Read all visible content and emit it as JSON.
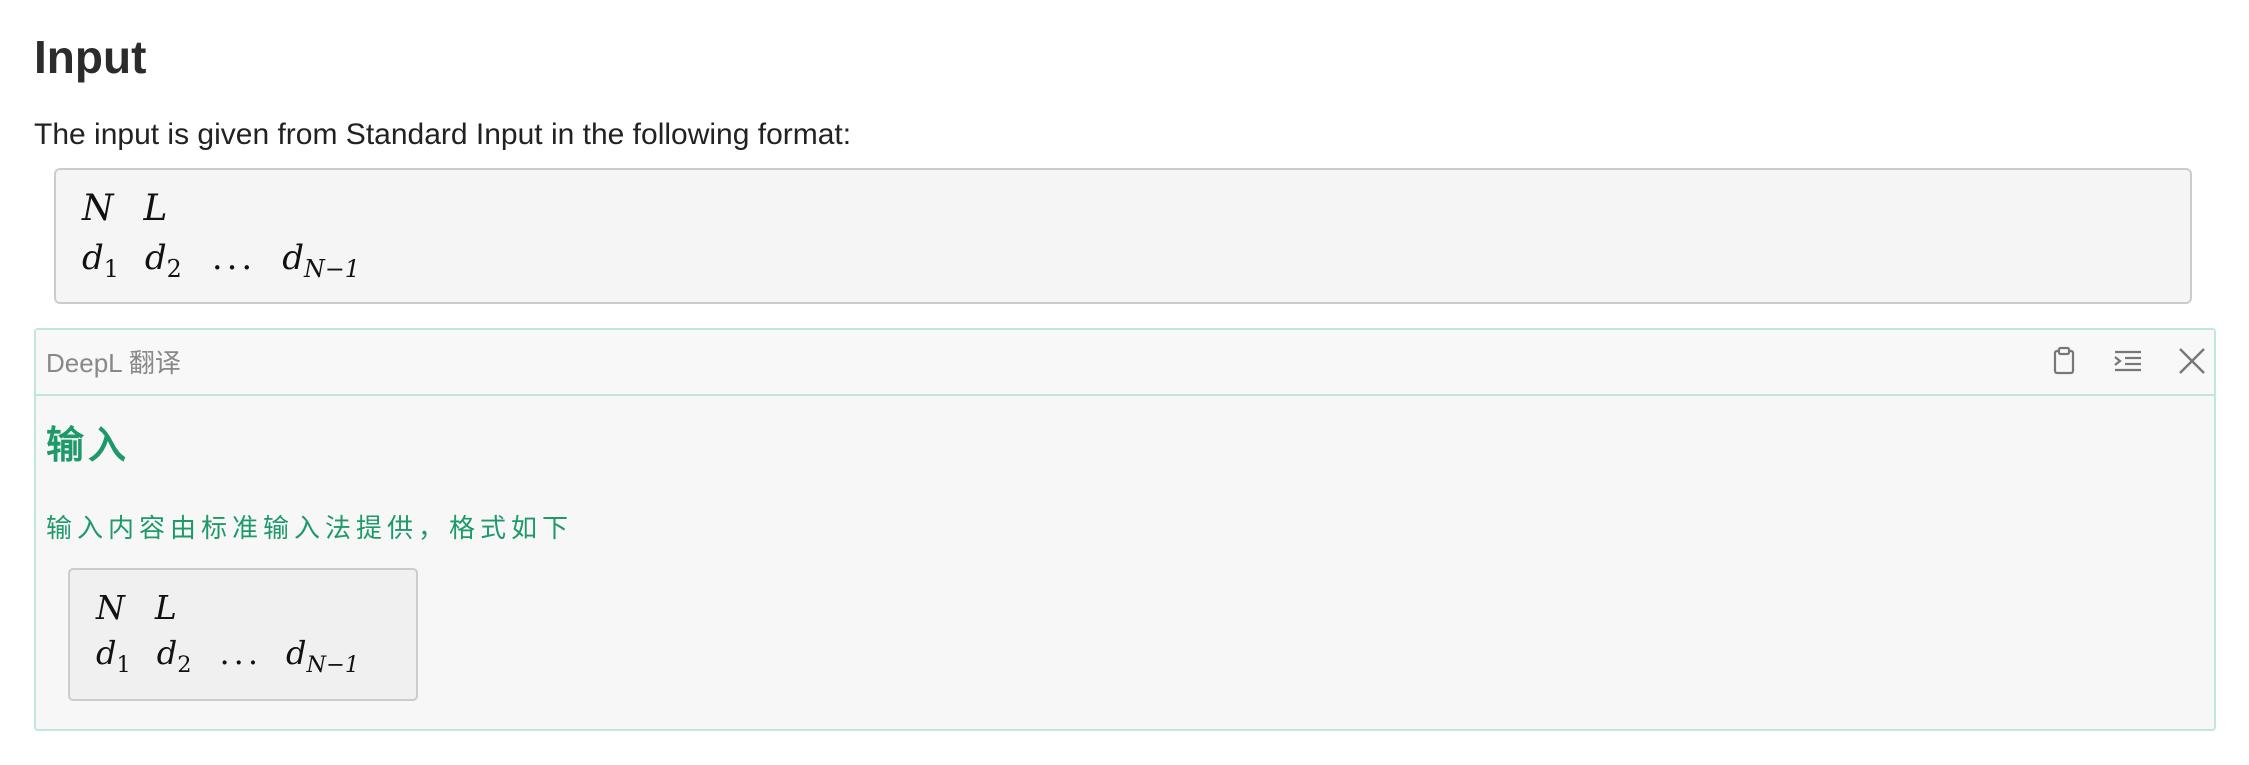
{
  "input_section": {
    "heading": "Input",
    "description": "The input is given from Standard Input in the following format:",
    "format": {
      "line1": [
        "N",
        "L"
      ],
      "line2": {
        "d1": "d",
        "d1_sub": "1",
        "d2": "d",
        "d2_sub": "2",
        "ellipsis": "...",
        "dlast": "d",
        "dlast_sub": "N−1"
      }
    }
  },
  "translation_panel": {
    "title": "DeepL 翻译",
    "icons": [
      "clipboard-icon",
      "indent-icon",
      "close-icon"
    ],
    "heading": "输入",
    "description": "输入内容由标准输入法提供，格式如下",
    "accent_color": "#1e9a6a",
    "border_color": "#bfe8d6"
  }
}
